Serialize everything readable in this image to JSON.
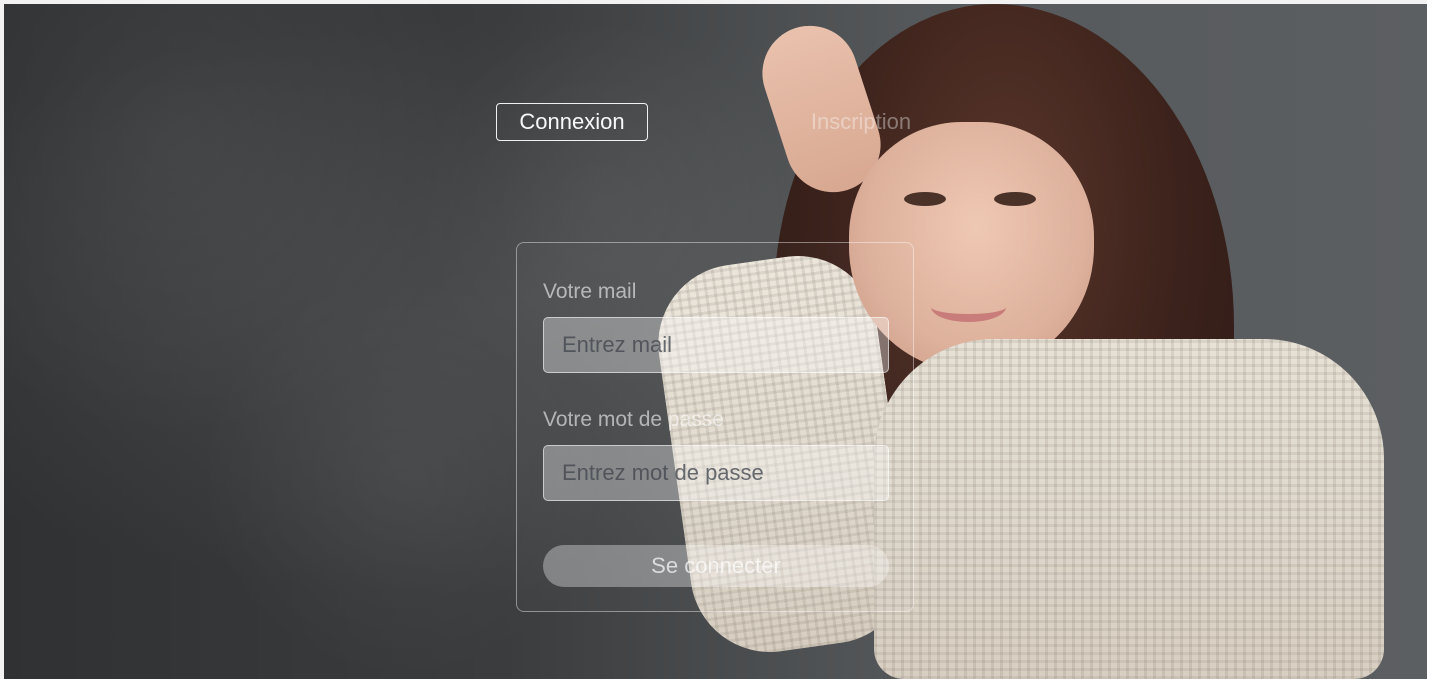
{
  "tabs": {
    "login": "Connexion",
    "signup": "Inscription"
  },
  "form": {
    "email_label": "Votre mail",
    "email_placeholder": "Entrez mail",
    "password_label": "Votre mot de passe",
    "password_placeholder": "Entrez mot de passe",
    "submit_label": "Se connecter"
  },
  "colors": {
    "accent": "#ffffff",
    "overlay_glass": "#ffffff"
  }
}
